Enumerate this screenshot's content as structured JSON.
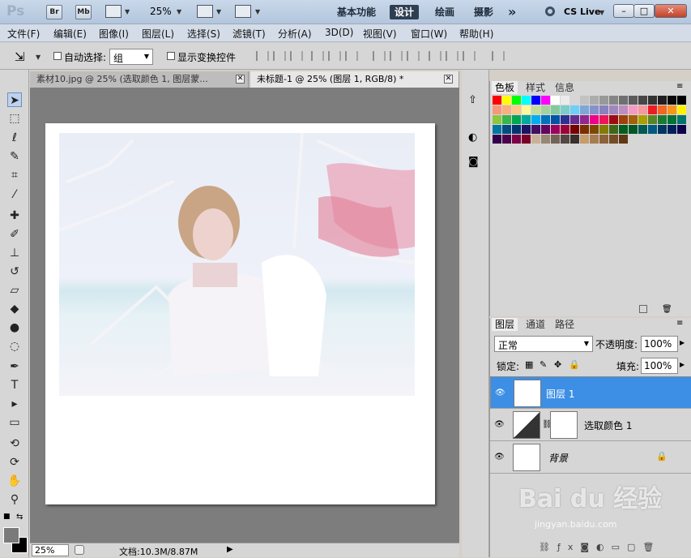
{
  "app": {
    "logo": "Ps",
    "br": "Br",
    "mb": "Mb",
    "zoom_select": "25%"
  },
  "workspaces": {
    "basic": "基本功能",
    "design": "设计",
    "paint": "绘画",
    "photo": "摄影",
    "more": "»",
    "cslive": "CS Live"
  },
  "window": {
    "minimize": "–",
    "restore": "□",
    "close": "✕"
  },
  "menu": [
    "文件(F)",
    "编辑(E)",
    "图像(I)",
    "图层(L)",
    "选择(S)",
    "滤镜(T)",
    "分析(A)",
    "3D(D)",
    "视图(V)",
    "窗口(W)",
    "帮助(H)"
  ],
  "options": {
    "auto_select_label": "自动选择:",
    "auto_select_value": "组",
    "show_transform_label": "显示变换控件"
  },
  "tabs": [
    {
      "label": "素材10.jpg @ 25% (选取颜色 1, 图层蒙...",
      "close": "✕"
    },
    {
      "label": "未标题-1 @ 25% (图层 1, RGB/8) *",
      "close": "✕"
    }
  ],
  "status": {
    "zoom": "25%",
    "doc_info": "文档:10.3M/8.87M"
  },
  "swatch_panel": {
    "tabs": [
      "色板",
      "样式",
      "信息"
    ]
  },
  "swatch_colors": [
    "#ff0000",
    "#ffff00",
    "#00ff00",
    "#00ffff",
    "#0000ff",
    "#ff00ff",
    "#ffffff",
    "#ebebeb",
    "#d6d6d6",
    "#c2c2c2",
    "#adadad",
    "#999999",
    "#858585",
    "#707070",
    "#5c5c5c",
    "#474747",
    "#333333",
    "#1f1f1f",
    "#0a0a0a",
    "#000000",
    "#f7977a",
    "#f9ad81",
    "#fdc68a",
    "#fff79a",
    "#c4df9b",
    "#a2d39c",
    "#82ca9d",
    "#7bcdc8",
    "#6ecff6",
    "#7ea7d8",
    "#8493ca",
    "#8882be",
    "#a187be",
    "#bc8dbf",
    "#f49ac2",
    "#f6989d",
    "#ed1c24",
    "#f26522",
    "#f7941d",
    "#fff200",
    "#8dc63f",
    "#39b54a",
    "#00a651",
    "#00a99d",
    "#00aeef",
    "#0072bc",
    "#0054a6",
    "#2e3192",
    "#662d91",
    "#92278f",
    "#ec008c",
    "#ed145b",
    "#9e0b0f",
    "#a0410d",
    "#a36209",
    "#aba000",
    "#598527",
    "#1a7b30",
    "#007236",
    "#00746b",
    "#0076a3",
    "#004b80",
    "#003471",
    "#1b1464",
    "#440e62",
    "#630460",
    "#9e005d",
    "#9e0039",
    "#790000",
    "#7b2e00",
    "#7d4900",
    "#827b00",
    "#406618",
    "#005e20",
    "#005826",
    "#005952",
    "#005b7f",
    "#003663",
    "#002157",
    "#0d004c",
    "#32004b",
    "#4b0049",
    "#7b0046",
    "#7a0026",
    "#c7b299",
    "#998675",
    "#736357",
    "#534741",
    "#37302d",
    "#c69c6d",
    "#a67c52",
    "#8c6239",
    "#754c24",
    "#603913"
  ],
  "layers_panel": {
    "tabs": [
      "图层",
      "通道",
      "路径"
    ],
    "blend_mode": "正常",
    "opacity_label": "不透明度:",
    "opacity_value": "100%",
    "lock_label": "锁定:",
    "fill_label": "填充:",
    "fill_value": "100%",
    "layers": [
      {
        "name": "图层 1",
        "selected": true
      },
      {
        "name": "选取颜色 1",
        "selected": false
      },
      {
        "name": "背景",
        "selected": false
      }
    ]
  },
  "watermark": {
    "main": "Bai du 经验",
    "sub": "jingyan.baidu.com"
  }
}
